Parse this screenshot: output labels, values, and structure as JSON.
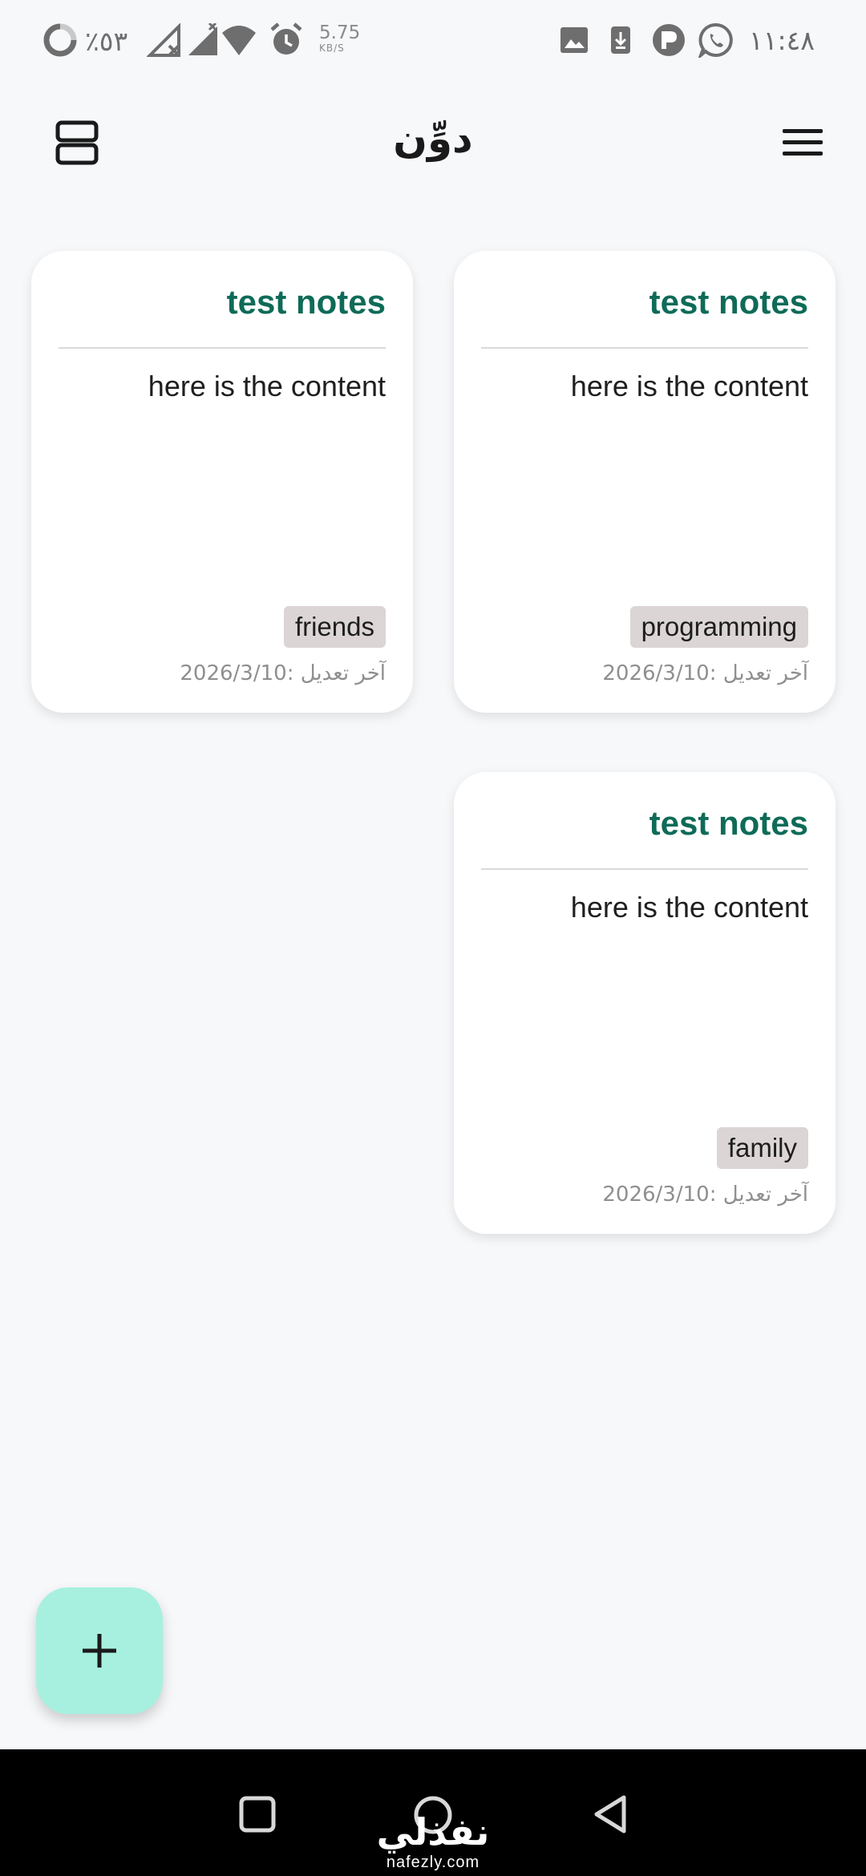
{
  "status_bar": {
    "battery_text": "٪٥٣",
    "net_speed_value": "5.75",
    "net_speed_unit": "KB/S",
    "time": "١١:٤٨",
    "left_icons": [
      "battery-ring-icon",
      "signal-off-icon",
      "signal-icon",
      "wifi-icon",
      "alarm-icon"
    ],
    "right_icons": [
      "image-icon",
      "download-icon",
      "app-p-icon",
      "whatsapp-icon"
    ]
  },
  "app_bar": {
    "title": "دوِّن",
    "layout_toggle_icon": "view-agenda-icon",
    "menu_icon": "menu-icon"
  },
  "notes": [
    {
      "title": "test notes",
      "content": "here is the content",
      "tag": "programming",
      "date": "آخر تعديل :2026/3/10"
    },
    {
      "title": "test notes",
      "content": "here is the content",
      "tag": "friends",
      "date": "آخر تعديل :2026/3/10"
    },
    {
      "title": "test notes",
      "content": "here is the content",
      "tag": "family",
      "date": "آخر تعديل :2026/3/10"
    }
  ],
  "fab": {
    "icon": "plus-icon"
  },
  "nav_bar": {
    "buttons": [
      "square-icon",
      "circle-icon",
      "back-triangle-icon"
    ]
  },
  "watermark": {
    "arabic": "نفذلي",
    "latin": "nafezly.com"
  },
  "colors": {
    "background": "#f7f8fa",
    "note_title": "#0e6b58",
    "tag_background": "#dcd5d5",
    "fab": "#a7f0df",
    "nav_bar": "#000000"
  }
}
